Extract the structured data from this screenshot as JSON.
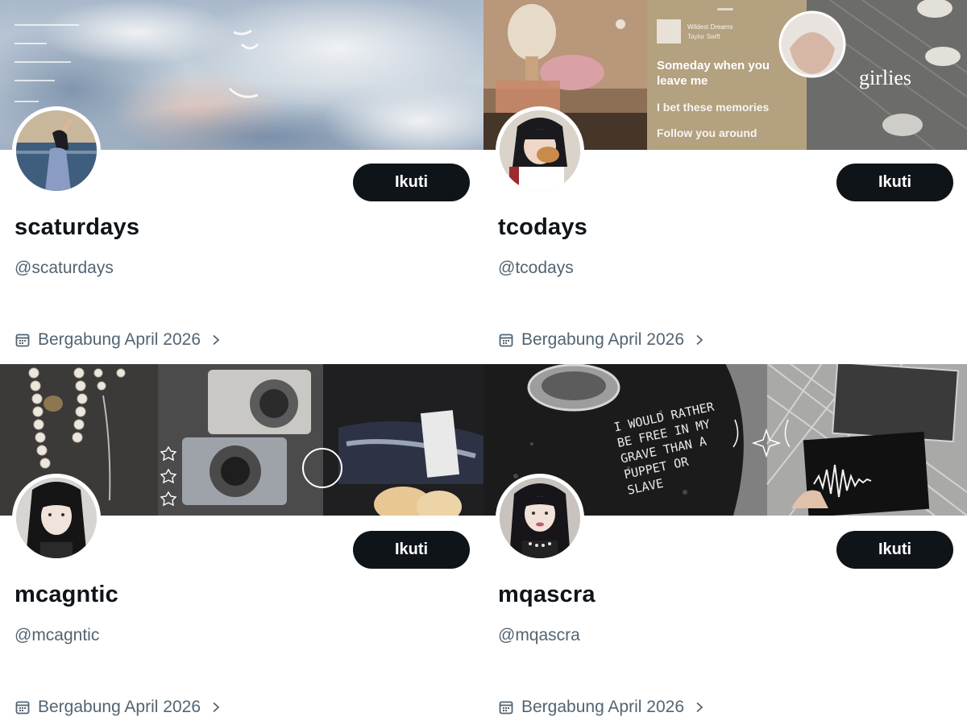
{
  "profiles": [
    {
      "display_name": "scaturdays",
      "handle": "@scaturdays",
      "joined": "Bergabung April 2026",
      "follow_label": "Ikuti",
      "banner_icon": "sky-clouds-banner",
      "avatar_icon": "person-by-sea-avatar"
    },
    {
      "display_name": "tcodays",
      "handle": "@tcodays",
      "joined": "Bergabung April 2026",
      "follow_label": "Ikuti",
      "banner_icon": "collage-banner",
      "avatar_icon": "person-eating-bread-avatar",
      "banner_text": {
        "song_title": "Wildest Dreams",
        "artist": "Taylor Swift",
        "lyric_1": "Someday when you",
        "lyric_2": "leave me",
        "lyric_3": "I bet these memories",
        "lyric_4": "Follow you around",
        "girlies": "girlies"
      }
    },
    {
      "display_name": "mcagntic",
      "handle": "@mcagntic",
      "joined": "Bergabung April 2026",
      "follow_label": "Ikuti",
      "banner_icon": "pearls-cameras-banner",
      "avatar_icon": "woman-portrait-avatar"
    },
    {
      "display_name": "mqascra",
      "handle": "@mqascra",
      "joined": "Bergabung April 2026",
      "follow_label": "Ikuti",
      "banner_icon": "guitar-vinyl-banner",
      "avatar_icon": "woman-dark-hair-avatar",
      "banner_text": {
        "scrawl": "I WOULD RATHER BE FREE IN MY GRAVE THAN A PUPPET OR SLAVE"
      }
    }
  ],
  "colors": {
    "button_bg": "#0f1419",
    "button_text": "#ffffff",
    "name_text": "#0f1419",
    "muted_text": "#536471"
  }
}
